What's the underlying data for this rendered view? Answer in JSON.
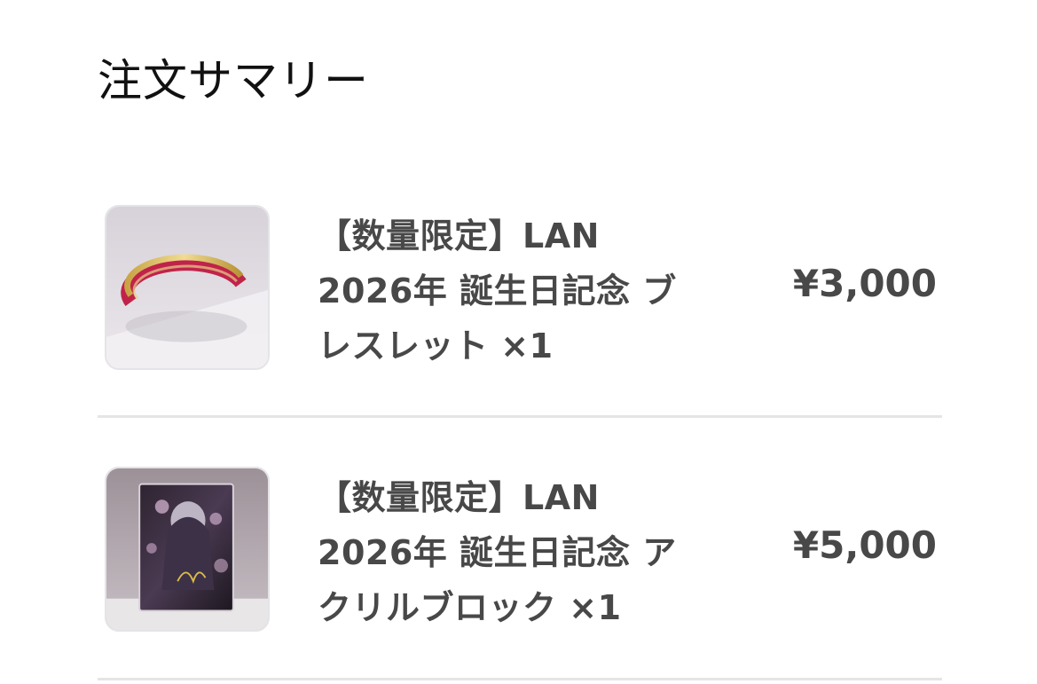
{
  "summary": {
    "title": "注文サマリー"
  },
  "items": [
    {
      "name": "【数量限定】LAN\n2026年 誕生日記念 ブ\nレスレット ×1",
      "price": "¥3,000",
      "image_icon": "bracelet-image"
    },
    {
      "name": "【数量限定】LAN\n2026年 誕生日記念 ア\nクリルブロック ×1",
      "price": "¥5,000",
      "image_icon": "acrylic-block-image"
    }
  ],
  "colors": {
    "text_primary": "#111111",
    "text_secondary": "#484848",
    "divider": "#e5e5e5",
    "bracelet_red": "#c0234a",
    "bracelet_gold": "#d8b85a"
  }
}
